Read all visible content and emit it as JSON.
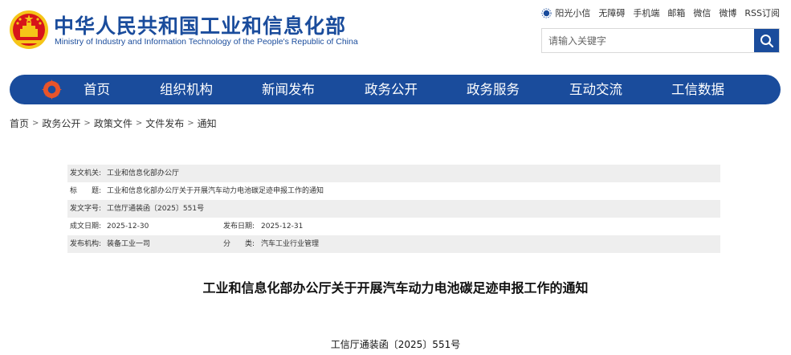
{
  "header": {
    "site_title": "中华人民共和国工业和信息化部",
    "site_subtitle": "Ministry of Industry and Information Technology of the People's Republic of China",
    "top_links": [
      "阳光小信",
      "无障碍",
      "手机端",
      "邮箱",
      "微信",
      "微博",
      "RSS订阅"
    ],
    "search_placeholder": "请输入关键字"
  },
  "nav": {
    "items": [
      "首页",
      "组织机构",
      "新闻发布",
      "政务公开",
      "政务服务",
      "互动交流",
      "工信数据"
    ]
  },
  "breadcrumb": [
    "首页",
    "政务公开",
    "政策文件",
    "文件发布",
    "通知"
  ],
  "meta": {
    "issuer_label": "发文机关:",
    "issuer": "工业和信息化部办公厅",
    "title_label": "标　　题:",
    "title": "工业和信息化部办公厅关于开展汽车动力电池碳足迹申报工作的通知",
    "number_label": "发文字号:",
    "number": "工信厅通装函〔2025〕551号",
    "date_label": "成文日期:",
    "date": "2025-12-30",
    "pub_date_label": "发布日期:",
    "pub_date": "2025-12-31",
    "org_label": "发布机构:",
    "org": "装备工业一司",
    "category_label": "分　　类:",
    "category": "汽车工业行业管理"
  },
  "document": {
    "title": "工业和信息化部办公厅关于开展汽车动力电池碳足迹申报工作的通知",
    "number": "工信厅通装函〔2025〕551号"
  },
  "colors": {
    "brand_blue": "#1a4c9c",
    "emblem_red": "#d7141a",
    "emblem_gold": "#f5c518",
    "meta_shade": "#eeeeee"
  },
  "icons": [
    "national-emblem",
    "sun-icon",
    "search-icon",
    "nav-logo-icon"
  ]
}
